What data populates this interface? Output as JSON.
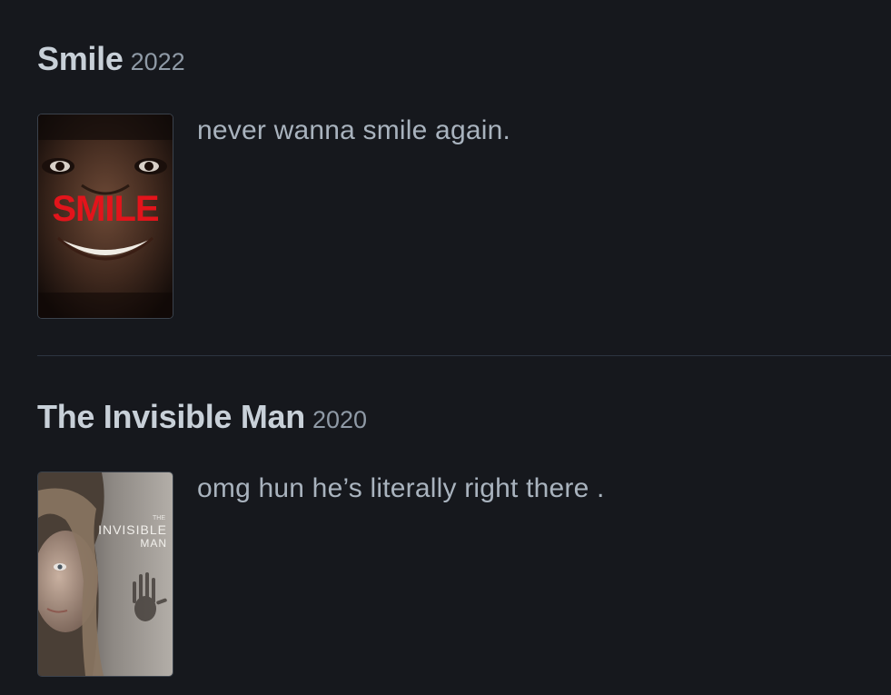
{
  "reviews": [
    {
      "title": "Smile",
      "year": "2022",
      "poster_text": "SMILE",
      "review": "never wanna smile again."
    },
    {
      "title": "The Invisible Man",
      "year": "2020",
      "poster_text": {
        "the": "THE",
        "invisible": "INVISIBLE",
        "man": "MAN"
      },
      "review": "omg hun he’s literally right there ."
    }
  ],
  "colors": {
    "background": "#16181d",
    "title": "#c8d0d8",
    "year": "#8f9aa6",
    "review": "#a9b3be",
    "divider": "#2c3440",
    "smile_logo": "#e3141b"
  }
}
